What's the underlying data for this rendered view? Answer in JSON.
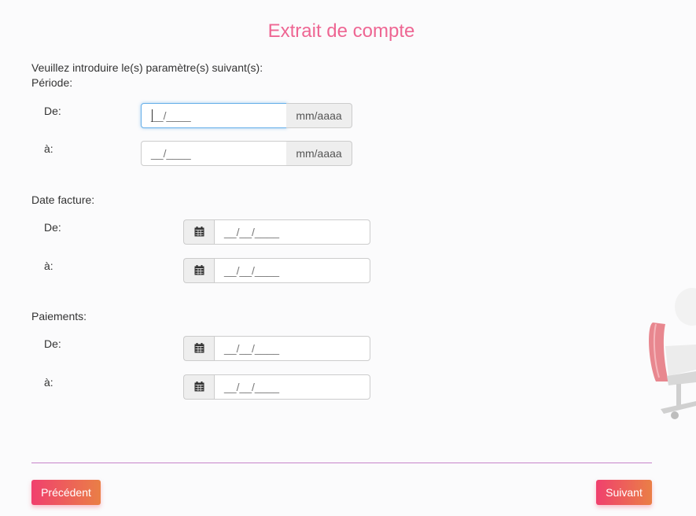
{
  "page": {
    "title": "Extrait de compte",
    "instructions": "Veuillez introduire le(s) paramètre(s) suivant(s):"
  },
  "periode": {
    "label": "Période:",
    "from_label": "De:",
    "to_label": "à:",
    "from_value": "__/____",
    "to_value": "__/____",
    "format_hint": "mm/aaaa"
  },
  "date_facture": {
    "label": "Date facture:",
    "from_label": "De:",
    "to_label": "à:",
    "from_value": "__/__/____",
    "to_value": "__/__/____"
  },
  "paiements": {
    "label": "Paiements:",
    "from_label": "De:",
    "to_label": "à:",
    "from_value": "__/__/____",
    "to_value": "__/__/____"
  },
  "buttons": {
    "previous": "Précédent",
    "next": "Suivant"
  },
  "icons": {
    "calendar": "calendar-icon",
    "decoration": "office-chair-illustration"
  },
  "colors": {
    "title": "#ee6693",
    "button_gradient_start": "#f0406e",
    "button_gradient_end": "#ea7f46",
    "divider": "#c783c9",
    "focus_border": "#66afe9"
  }
}
